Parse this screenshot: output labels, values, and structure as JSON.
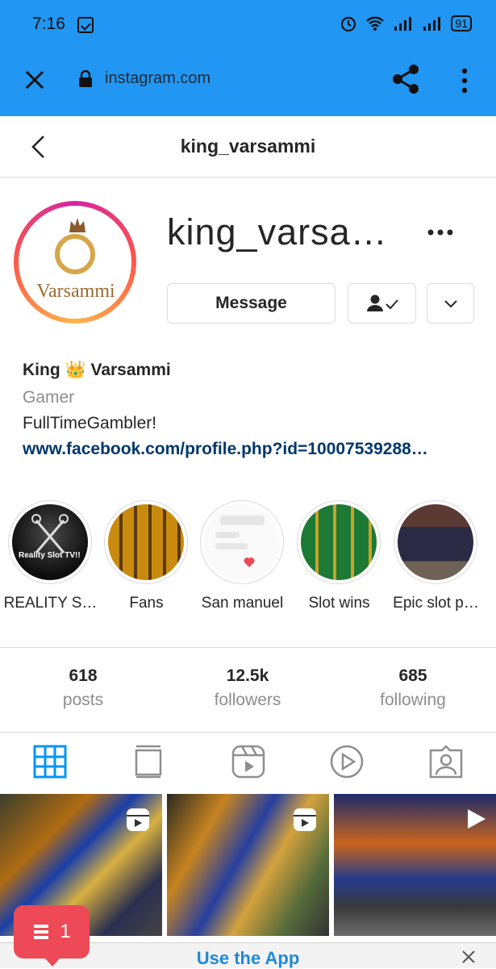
{
  "status_bar": {
    "time": "7:16",
    "battery": "91"
  },
  "browser": {
    "url": "instagram.com"
  },
  "header": {
    "title": "king_varsammi"
  },
  "profile": {
    "username": "king_varsa…",
    "avatar_text": "Varsammi",
    "buttons": {
      "message": "Message"
    }
  },
  "bio": {
    "name": "King 👑 Varsammi",
    "category": "Gamer",
    "text": "FullTimeGambler!",
    "link": "www.facebook.com/profile.php?id=10007539288…"
  },
  "highlights": [
    {
      "label": "REALITY S…",
      "caption": "Reality Slot TV!!"
    },
    {
      "label": "Fans"
    },
    {
      "label": "San manuel"
    },
    {
      "label": "Slot wins"
    },
    {
      "label": "Epic slot p…"
    }
  ],
  "stats": [
    {
      "value": "618",
      "label": "posts"
    },
    {
      "value": "12.5k",
      "label": "followers"
    },
    {
      "value": "685",
      "label": "following"
    }
  ],
  "tabs": [
    "grid-icon",
    "guide-icon",
    "reels-icon",
    "video-icon",
    "tagged-icon"
  ],
  "banner": {
    "text": "Use the App"
  },
  "notification": {
    "count": "1"
  },
  "colors": {
    "accent": "#2196f3",
    "link": "#00376b",
    "badge": "#ed4956"
  }
}
